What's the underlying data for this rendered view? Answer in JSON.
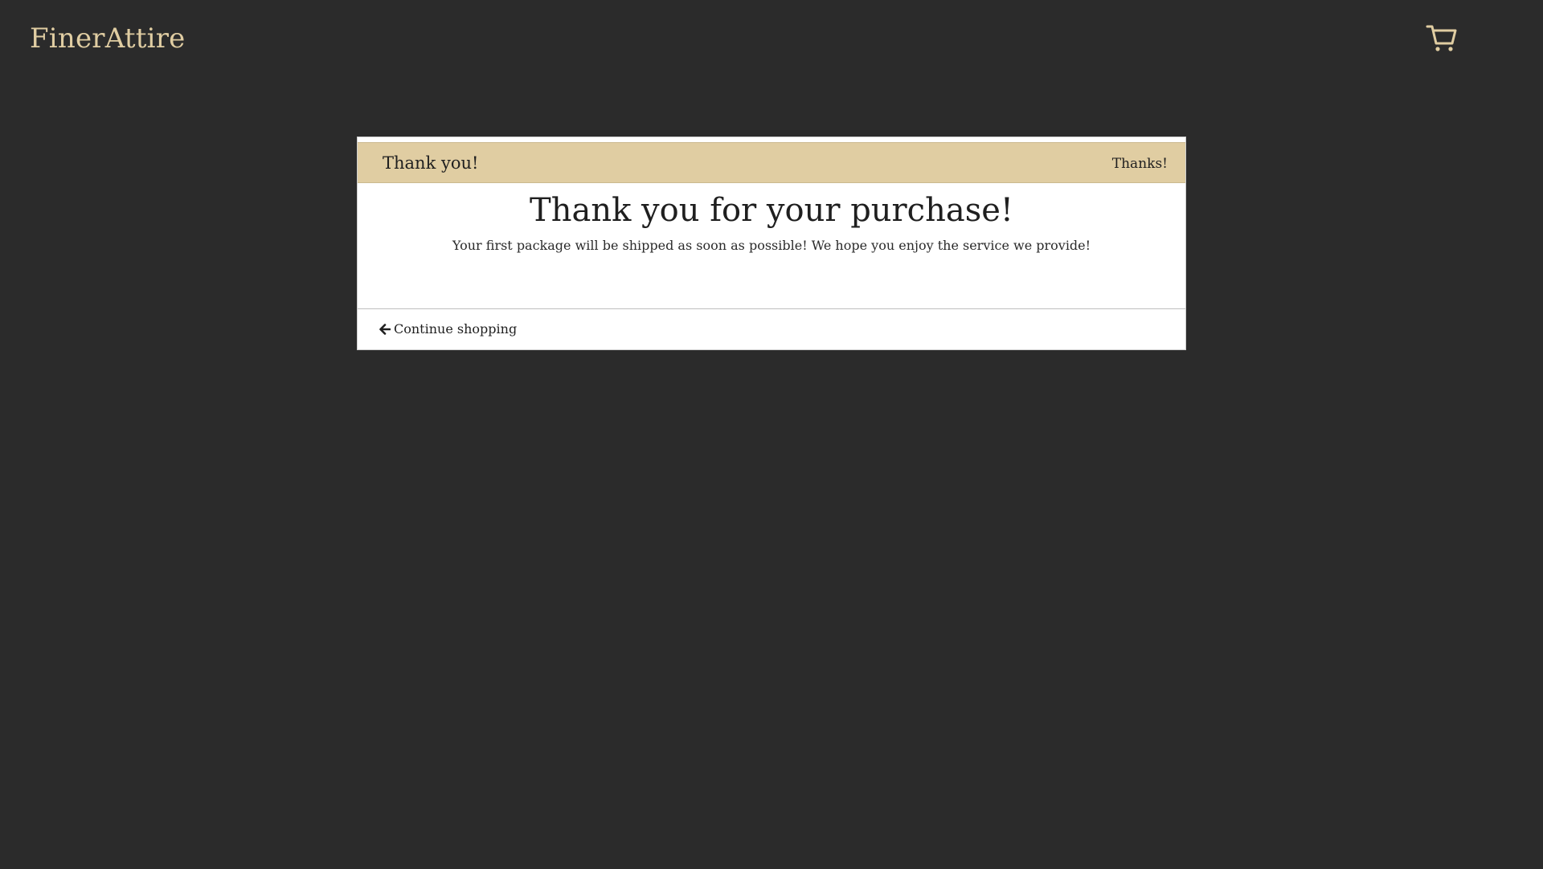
{
  "header": {
    "brand": "FinerAttire",
    "cart_icon": "cart-icon",
    "accent_color": "#e0cda2"
  },
  "card": {
    "header_title": "Thank you!",
    "header_right": "Thanks!",
    "headline": "Thank you for your purchase!",
    "message": "Your first package will be shipped as soon as possible! We hope you enjoy the service we provide!",
    "continue_label": "Continue shopping",
    "continue_icon": "arrow-left-icon"
  },
  "colors": {
    "background": "#2b2b2b",
    "card": "#ffffff",
    "text": "#1f1f1f"
  }
}
